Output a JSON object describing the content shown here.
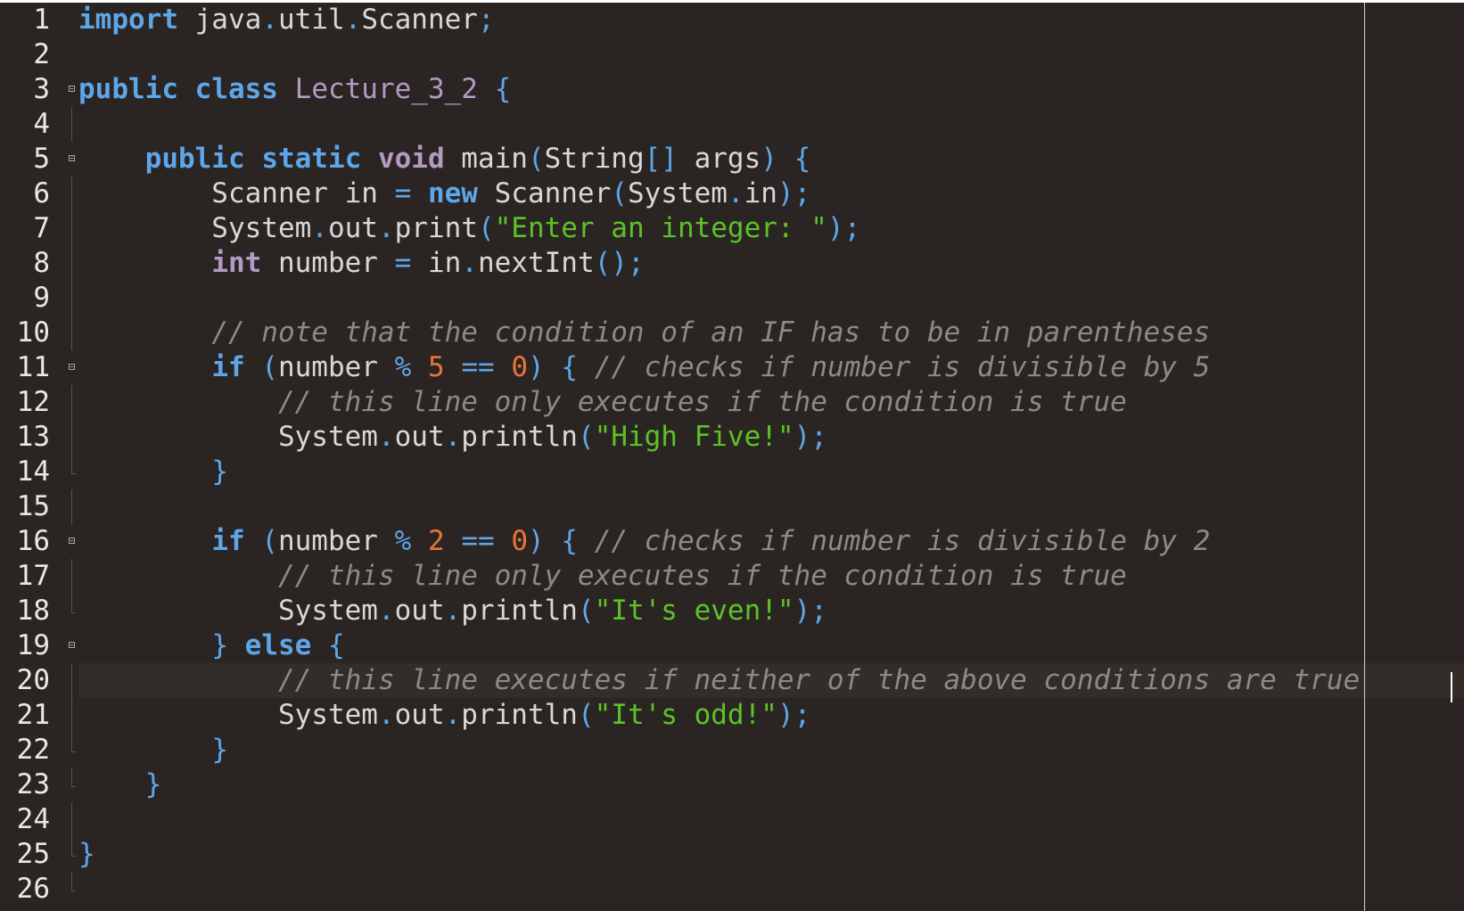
{
  "editor": {
    "language": "java",
    "current_line": 20,
    "lines": [
      {
        "n": "1",
        "fold": "",
        "tokens": [
          [
            "kw",
            "import"
          ],
          [
            "plain",
            " java"
          ],
          [
            "op",
            "."
          ],
          [
            "plain",
            "util"
          ],
          [
            "op",
            "."
          ],
          [
            "plain",
            "Scanner"
          ],
          [
            "op",
            ";"
          ]
        ]
      },
      {
        "n": "2",
        "fold": "",
        "tokens": []
      },
      {
        "n": "3",
        "fold": "open",
        "tokens": [
          [
            "kw",
            "public"
          ],
          [
            "plain",
            " "
          ],
          [
            "kw",
            "class"
          ],
          [
            "plain",
            " "
          ],
          [
            "cls",
            "Lecture_3_2"
          ],
          [
            "plain",
            " "
          ],
          [
            "op",
            "{"
          ]
        ]
      },
      {
        "n": "4",
        "fold": "line",
        "tokens": []
      },
      {
        "n": "5",
        "fold": "open",
        "tokens": [
          [
            "plain",
            "    "
          ],
          [
            "kw",
            "public"
          ],
          [
            "plain",
            " "
          ],
          [
            "kw",
            "static"
          ],
          [
            "plain",
            " "
          ],
          [
            "type",
            "void"
          ],
          [
            "plain",
            " main"
          ],
          [
            "op",
            "("
          ],
          [
            "plain",
            "String"
          ],
          [
            "op",
            "[]"
          ],
          [
            "plain",
            " args"
          ],
          [
            "op",
            ")"
          ],
          [
            "plain",
            " "
          ],
          [
            "op",
            "{"
          ]
        ]
      },
      {
        "n": "6",
        "fold": "line",
        "tokens": [
          [
            "plain",
            "        Scanner in "
          ],
          [
            "op",
            "="
          ],
          [
            "plain",
            " "
          ],
          [
            "kw",
            "new"
          ],
          [
            "plain",
            " Scanner"
          ],
          [
            "op",
            "("
          ],
          [
            "plain",
            "System"
          ],
          [
            "op",
            "."
          ],
          [
            "plain",
            "in"
          ],
          [
            "op",
            ");"
          ]
        ]
      },
      {
        "n": "7",
        "fold": "line",
        "tokens": [
          [
            "plain",
            "        System"
          ],
          [
            "op",
            "."
          ],
          [
            "plain",
            "out"
          ],
          [
            "op",
            "."
          ],
          [
            "plain",
            "print"
          ],
          [
            "op",
            "("
          ],
          [
            "str",
            "\"Enter an integer: \""
          ],
          [
            "op",
            ");"
          ]
        ]
      },
      {
        "n": "8",
        "fold": "line",
        "tokens": [
          [
            "plain",
            "        "
          ],
          [
            "type",
            "int"
          ],
          [
            "plain",
            " number "
          ],
          [
            "op",
            "="
          ],
          [
            "plain",
            " in"
          ],
          [
            "op",
            "."
          ],
          [
            "plain",
            "nextInt"
          ],
          [
            "op",
            "();"
          ]
        ]
      },
      {
        "n": "9",
        "fold": "line",
        "tokens": []
      },
      {
        "n": "10",
        "fold": "line",
        "tokens": [
          [
            "plain",
            "        "
          ],
          [
            "cmt",
            "// note that the condition of an IF has to be in parentheses"
          ]
        ]
      },
      {
        "n": "11",
        "fold": "open",
        "tokens": [
          [
            "plain",
            "        "
          ],
          [
            "kw",
            "if"
          ],
          [
            "plain",
            " "
          ],
          [
            "op",
            "("
          ],
          [
            "plain",
            "number "
          ],
          [
            "op",
            "%"
          ],
          [
            "plain",
            " "
          ],
          [
            "num",
            "5"
          ],
          [
            "plain",
            " "
          ],
          [
            "op",
            "=="
          ],
          [
            "plain",
            " "
          ],
          [
            "num",
            "0"
          ],
          [
            "op",
            ")"
          ],
          [
            "plain",
            " "
          ],
          [
            "op",
            "{"
          ],
          [
            "plain",
            " "
          ],
          [
            "cmt",
            "// checks if number is divisible by 5"
          ]
        ]
      },
      {
        "n": "12",
        "fold": "line",
        "tokens": [
          [
            "plain",
            "            "
          ],
          [
            "cmt",
            "// this line only executes if the condition is true"
          ]
        ]
      },
      {
        "n": "13",
        "fold": "line",
        "tokens": [
          [
            "plain",
            "            System"
          ],
          [
            "op",
            "."
          ],
          [
            "plain",
            "out"
          ],
          [
            "op",
            "."
          ],
          [
            "plain",
            "println"
          ],
          [
            "op",
            "("
          ],
          [
            "str",
            "\"High Five!\""
          ],
          [
            "op",
            ");"
          ]
        ]
      },
      {
        "n": "14",
        "fold": "end",
        "tokens": [
          [
            "plain",
            "        "
          ],
          [
            "op",
            "}"
          ]
        ]
      },
      {
        "n": "15",
        "fold": "line",
        "tokens": []
      },
      {
        "n": "16",
        "fold": "open",
        "tokens": [
          [
            "plain",
            "        "
          ],
          [
            "kw",
            "if"
          ],
          [
            "plain",
            " "
          ],
          [
            "op",
            "("
          ],
          [
            "plain",
            "number "
          ],
          [
            "op",
            "%"
          ],
          [
            "plain",
            " "
          ],
          [
            "num",
            "2"
          ],
          [
            "plain",
            " "
          ],
          [
            "op",
            "=="
          ],
          [
            "plain",
            " "
          ],
          [
            "num",
            "0"
          ],
          [
            "op",
            ")"
          ],
          [
            "plain",
            " "
          ],
          [
            "op",
            "{"
          ],
          [
            "plain",
            " "
          ],
          [
            "cmt",
            "// checks if number is divisible by 2"
          ]
        ]
      },
      {
        "n": "17",
        "fold": "line",
        "tokens": [
          [
            "plain",
            "            "
          ],
          [
            "cmt",
            "// this line only executes if the condition is true"
          ]
        ]
      },
      {
        "n": "18",
        "fold": "end",
        "tokens": [
          [
            "plain",
            "            System"
          ],
          [
            "op",
            "."
          ],
          [
            "plain",
            "out"
          ],
          [
            "op",
            "."
          ],
          [
            "plain",
            "println"
          ],
          [
            "op",
            "("
          ],
          [
            "str",
            "\"It's even!\""
          ],
          [
            "op",
            ");"
          ]
        ]
      },
      {
        "n": "19",
        "fold": "open",
        "tokens": [
          [
            "plain",
            "        "
          ],
          [
            "op",
            "}"
          ],
          [
            "plain",
            " "
          ],
          [
            "kw",
            "else"
          ],
          [
            "plain",
            " "
          ],
          [
            "op",
            "{"
          ]
        ]
      },
      {
        "n": "20",
        "fold": "line",
        "tokens": [
          [
            "plain",
            "            "
          ],
          [
            "cmt",
            "// this line executes if neither of the above conditions are true"
          ]
        ]
      },
      {
        "n": "21",
        "fold": "line",
        "tokens": [
          [
            "plain",
            "            System"
          ],
          [
            "op",
            "."
          ],
          [
            "plain",
            "out"
          ],
          [
            "op",
            "."
          ],
          [
            "plain",
            "println"
          ],
          [
            "op",
            "("
          ],
          [
            "str",
            "\"It's odd!\""
          ],
          [
            "op",
            ");"
          ]
        ]
      },
      {
        "n": "22",
        "fold": "end",
        "tokens": [
          [
            "plain",
            "        "
          ],
          [
            "op",
            "}"
          ]
        ]
      },
      {
        "n": "23",
        "fold": "end",
        "tokens": [
          [
            "plain",
            "    "
          ],
          [
            "op",
            "}"
          ]
        ]
      },
      {
        "n": "24",
        "fold": "line",
        "tokens": []
      },
      {
        "n": "25",
        "fold": "end",
        "tokens": [
          [
            "op",
            "}"
          ]
        ]
      },
      {
        "n": "26",
        "fold": "end",
        "tokens": []
      }
    ]
  },
  "colors": {
    "background": "#2a2522",
    "keyword": "#5ea6ea",
    "type": "#b49ac2",
    "string": "#5cc227",
    "number": "#e8743c",
    "comment": "#8a8a8a",
    "text": "#d8d8d8",
    "line_number": "#e8e8e8"
  },
  "icons": {
    "fold_marker": "fold-collapse-icon"
  }
}
